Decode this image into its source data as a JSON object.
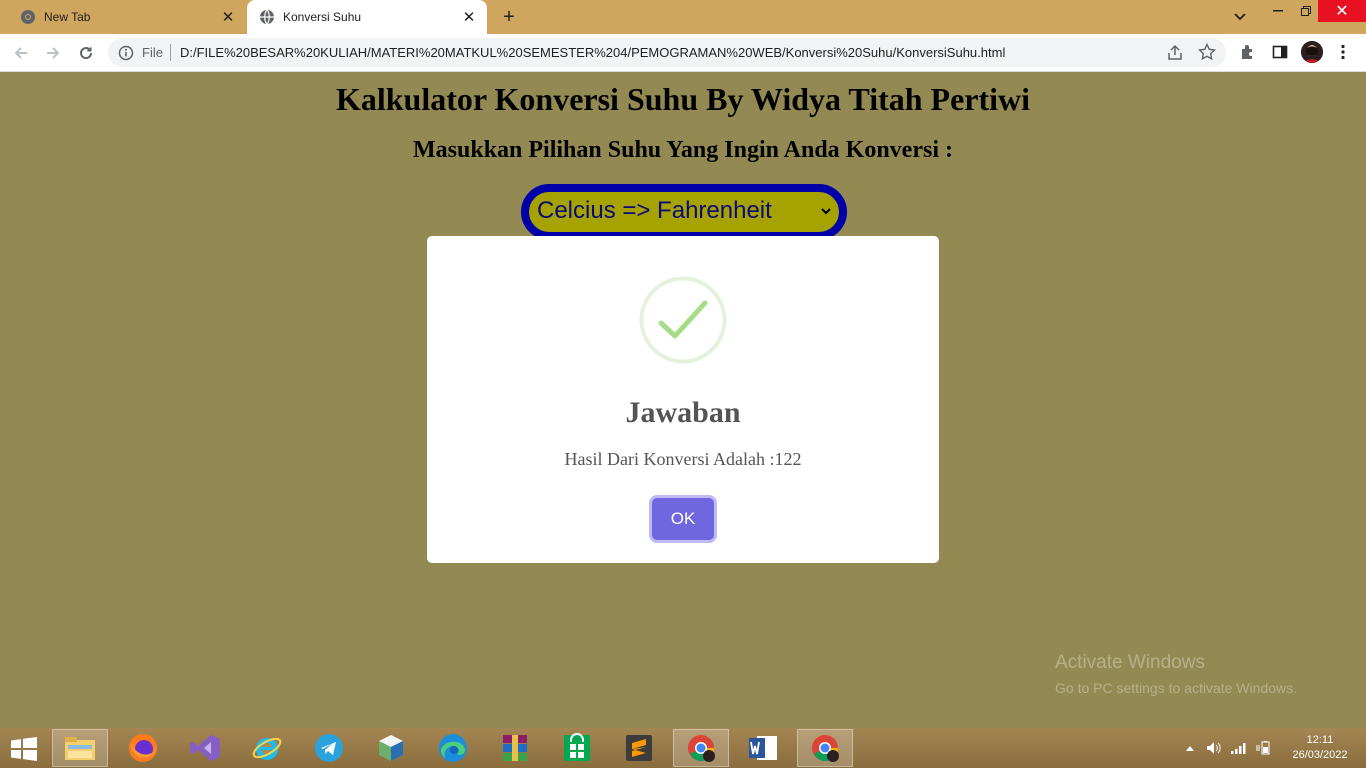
{
  "browser": {
    "tabs": [
      {
        "title": "New Tab",
        "active": false
      },
      {
        "title": "Konversi Suhu",
        "active": true
      }
    ],
    "address": {
      "scheme_label": "File",
      "url": "D:/FILE%20BESAR%20KULIAH/MATERI%20MATKUL%20SEMESTER%204/PEMOGRAMAN%20WEB/Konversi%20Suhu/KonversiSuhu.html"
    }
  },
  "page": {
    "title": "Kalkulator Konversi Suhu By Widya Titah Pertiwi",
    "subtitle": "Masukkan Pilihan Suhu Yang Ingin Anda Konversi :",
    "select": {
      "selected": "Celcius => Fahrenheit"
    }
  },
  "dialog": {
    "icon": "success-check",
    "title": "Jawaban",
    "text": "Hasil Dari Konversi Adalah :122",
    "confirm_label": "OK"
  },
  "watermark": {
    "line1": "Activate Windows",
    "line2": "Go to PC settings to activate Windows."
  },
  "taskbar": {
    "apps": [
      "file-explorer",
      "firefox",
      "visual-studio",
      "internet-explorer",
      "telegram",
      "virtualbox",
      "edge",
      "winrar",
      "store",
      "sublime-text",
      "chrome",
      "word",
      "chrome"
    ],
    "time": "12:11",
    "date": "26/03/2022"
  },
  "colors": {
    "page_bg": "#928a52",
    "select_border": "#0000a8",
    "select_bg": "#a6a200",
    "ok_button": "#7066e0",
    "success": "#a5dc86"
  }
}
